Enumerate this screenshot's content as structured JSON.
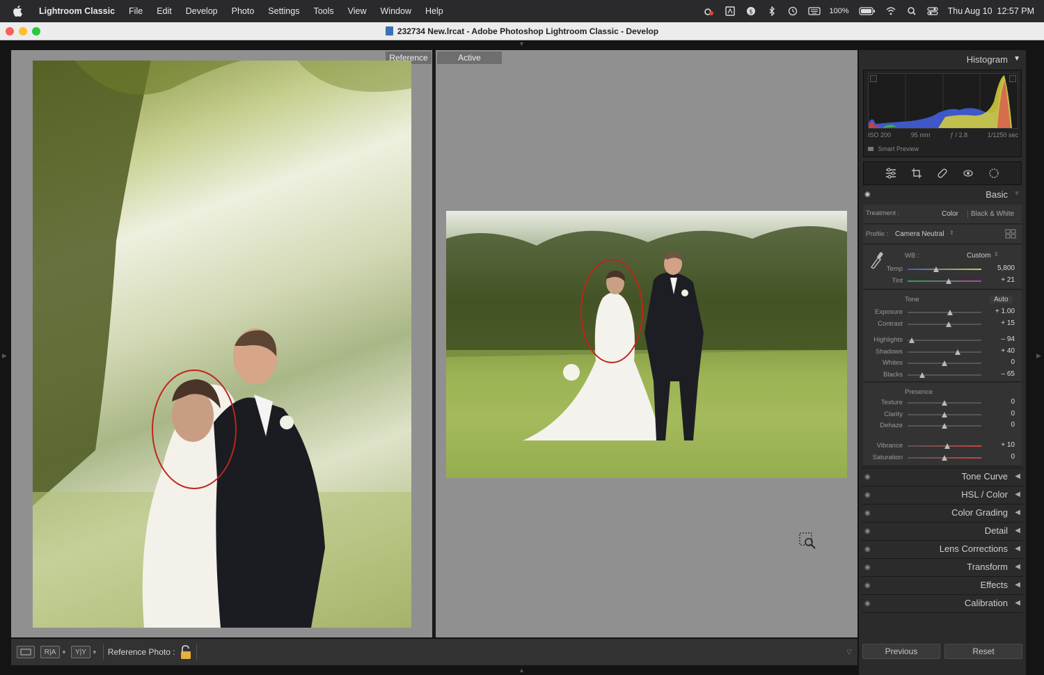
{
  "menubar": {
    "app": "Lightroom Classic",
    "items": [
      "File",
      "Edit",
      "Develop",
      "Photo",
      "Settings",
      "Tools",
      "View",
      "Window",
      "Help"
    ],
    "battery": "100%",
    "datetime": "Thu Aug 10  12:57 PM"
  },
  "window": {
    "title": "232734 New.lrcat - Adobe Photoshop Lightroom Classic - Develop"
  },
  "compare": {
    "reference_label": "Reference",
    "active_label": "Active"
  },
  "toolbar": {
    "compare_btn_a": "R|A",
    "compare_btn_b": "Y|Y",
    "reference_photo_label": "Reference Photo :"
  },
  "histogram": {
    "title": "Histogram",
    "iso": "ISO 200",
    "focal": "95 mm",
    "aperture": "ƒ / 2.8",
    "shutter": "1/1250 sec",
    "smart_preview": "Smart Preview"
  },
  "basic": {
    "title": "Basic",
    "treatment_label": "Treatment :",
    "treatment_color": "Color",
    "treatment_bw": "Black & White",
    "profile_label": "Profile :",
    "profile_value": "Camera Neutral",
    "wb_label": "WB :",
    "wb_value": "Custom",
    "tone_label": "Tone",
    "auto_label": "Auto",
    "presence_label": "Presence",
    "sliders": [
      {
        "label": "Temp",
        "value": "5,800",
        "pos": 0.39
      },
      {
        "label": "Tint",
        "value": "+ 21",
        "pos": 0.56
      },
      {
        "label": "Exposure",
        "value": "+ 1.00",
        "pos": 0.58
      },
      {
        "label": "Contrast",
        "value": "+ 15",
        "pos": 0.56
      },
      {
        "label": "Highlights",
        "value": "– 94",
        "pos": 0.06
      },
      {
        "label": "Shadows",
        "value": "+ 40",
        "pos": 0.68
      },
      {
        "label": "Whites",
        "value": "0",
        "pos": 0.5
      },
      {
        "label": "Blacks",
        "value": "– 65",
        "pos": 0.2
      },
      {
        "label": "Texture",
        "value": "0",
        "pos": 0.5
      },
      {
        "label": "Clarity",
        "value": "0",
        "pos": 0.5
      },
      {
        "label": "Dehaze",
        "value": "0",
        "pos": 0.5
      },
      {
        "label": "Vibrance",
        "value": "+ 10",
        "pos": 0.54
      },
      {
        "label": "Saturation",
        "value": "0",
        "pos": 0.5
      }
    ]
  },
  "panels": [
    "Tone Curve",
    "HSL / Color",
    "Color Grading",
    "Detail",
    "Lens Corrections",
    "Transform",
    "Effects",
    "Calibration"
  ],
  "buttons": {
    "previous": "Previous",
    "reset": "Reset"
  }
}
